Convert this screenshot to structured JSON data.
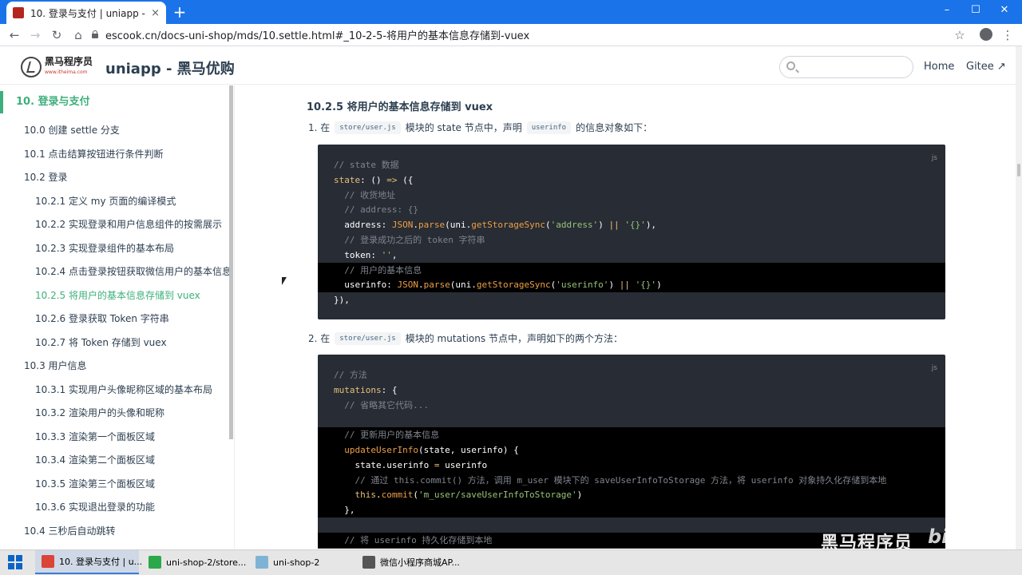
{
  "browser": {
    "tab_title": "10. 登录与支付 | uniapp - 黑马优...",
    "tab_close": "×",
    "new_tab": "+",
    "url": "escook.cn/docs-uni-shop/mds/10.settle.html#_10-2-5-将用户的基本信息存储到-vuex",
    "back": "←",
    "forward": "→",
    "reload": "↻",
    "home": "⌂",
    "bookmark": "☆",
    "menu": "⋮",
    "min": "–",
    "max": "☐",
    "close": "✕"
  },
  "site": {
    "logo_text": "黑马程序员",
    "logo_sub": "www.itheima.com",
    "title": "uniapp - 黑马优购",
    "search_placeholder": "",
    "nav": [
      "Home",
      "Gitee ↗"
    ]
  },
  "sidebar": {
    "top": "10. 登录与支付",
    "items": [
      {
        "label": "10.0 创建 settle 分支",
        "level": 1
      },
      {
        "label": "10.1 点击结算按钮进行条件判断",
        "level": 1
      },
      {
        "label": "10.2 登录",
        "level": 1
      },
      {
        "label": "10.2.1 定义 my 页面的编译模式",
        "level": 2
      },
      {
        "label": "10.2.2 实现登录和用户信息组件的按需展示",
        "level": 2
      },
      {
        "label": "10.2.3 实现登录组件的基本布局",
        "level": 2
      },
      {
        "label": "10.2.4 点击登录按钮获取微信用户的基本信息",
        "level": 2
      },
      {
        "label": "10.2.5 将用户的基本信息存储到 vuex",
        "level": 2,
        "active": true
      },
      {
        "label": "10.2.6 登录获取 Token 字符串",
        "level": 2
      },
      {
        "label": "10.2.7 将 Token 存储到 vuex",
        "level": 2
      },
      {
        "label": "10.3 用户信息",
        "level": 1
      },
      {
        "label": "10.3.1 实现用户头像昵称区域的基本布局",
        "level": 2
      },
      {
        "label": "10.3.2 渲染用户的头像和昵称",
        "level": 2
      },
      {
        "label": "10.3.3 渲染第一个面板区域",
        "level": 2
      },
      {
        "label": "10.3.4 渲染第二个面板区域",
        "level": 2
      },
      {
        "label": "10.3.5 渲染第三个面板区域",
        "level": 2
      },
      {
        "label": "10.3.6 实现退出登录的功能",
        "level": 2
      },
      {
        "label": "10.4 三秒后自动跳转",
        "level": 1
      }
    ]
  },
  "content": {
    "heading": "10.2.5 将用户的基本信息存储到 vuex",
    "step1": {
      "num": "1. 在",
      "code": "store/user.js",
      "mid": "模块的 state 节点中，声明",
      "code2": "userinfo",
      "end": "的信息对象如下："
    },
    "step2": {
      "num": "2. 在",
      "code": "store/user.js",
      "mid": "模块的 mutations 节点中，声明如下的两个方法："
    },
    "lang": "js",
    "code1": [
      {
        "hl": false,
        "parts": [
          [
            "c",
            "// state 数据"
          ]
        ]
      },
      {
        "hl": false,
        "parts": [
          [
            "k",
            "state"
          ],
          [
            "w",
            ": () "
          ],
          [
            "k",
            "=>"
          ],
          [
            "w",
            " ({"
          ]
        ]
      },
      {
        "hl": false,
        "parts": [
          [
            "c",
            "  // 收货地址"
          ]
        ]
      },
      {
        "hl": false,
        "parts": [
          [
            "c",
            "  // address: {}"
          ]
        ]
      },
      {
        "hl": false,
        "parts": [
          [
            "w",
            "  address: "
          ],
          [
            "f",
            "JSON"
          ],
          [
            "w",
            "."
          ],
          [
            "f",
            "parse"
          ],
          [
            "w",
            "(uni."
          ],
          [
            "f",
            "getStorageSync"
          ],
          [
            "w",
            "("
          ],
          [
            "s",
            "'address'"
          ],
          [
            "w",
            ") "
          ],
          [
            "p",
            "||"
          ],
          [
            "w",
            " "
          ],
          [
            "s",
            "'{}'"
          ],
          [
            "w",
            "),"
          ]
        ]
      },
      {
        "hl": false,
        "parts": [
          [
            "c",
            "  // 登录成功之后的 token 字符串"
          ]
        ]
      },
      {
        "hl": false,
        "parts": [
          [
            "w",
            "  token: "
          ],
          [
            "s",
            "''"
          ],
          [
            "w",
            ","
          ]
        ]
      },
      {
        "hl": true,
        "parts": [
          [
            "c",
            "  // 用户的基本信息"
          ]
        ]
      },
      {
        "hl": true,
        "parts": [
          [
            "w",
            "  userinfo: "
          ],
          [
            "f",
            "JSON"
          ],
          [
            "w",
            "."
          ],
          [
            "f",
            "parse"
          ],
          [
            "w",
            "(uni."
          ],
          [
            "f",
            "getStorageSync"
          ],
          [
            "w",
            "("
          ],
          [
            "s",
            "'userinfo'"
          ],
          [
            "w",
            ") "
          ],
          [
            "p",
            "||"
          ],
          [
            "w",
            " "
          ],
          [
            "s",
            "'{}'"
          ],
          [
            "w",
            ")"
          ]
        ]
      },
      {
        "hl": false,
        "parts": [
          [
            "w",
            "}),"
          ]
        ]
      }
    ],
    "code2": [
      {
        "hl": false,
        "parts": [
          [
            "c",
            "// 方法"
          ]
        ]
      },
      {
        "hl": false,
        "parts": [
          [
            "k",
            "mutations"
          ],
          [
            "w",
            ": {"
          ]
        ]
      },
      {
        "hl": false,
        "parts": [
          [
            "c",
            "  // 省略其它代码..."
          ]
        ]
      },
      {
        "hl": false,
        "parts": [
          [
            "w",
            ""
          ]
        ]
      },
      {
        "hl": true,
        "parts": [
          [
            "c",
            "  // 更新用户的基本信息"
          ]
        ]
      },
      {
        "hl": true,
        "parts": [
          [
            "f",
            "  updateUserInfo"
          ],
          [
            "w",
            "(state, userinfo) {"
          ]
        ]
      },
      {
        "hl": true,
        "parts": [
          [
            "w",
            "    state.userinfo "
          ],
          [
            "p",
            "="
          ],
          [
            "w",
            " userinfo"
          ]
        ]
      },
      {
        "hl": true,
        "parts": [
          [
            "c",
            "    // 通过 this.commit() 方法，调用 m_user 模块下的 saveUserInfoToStorage 方法，将 userinfo 对象持久化存储到本地"
          ]
        ]
      },
      {
        "hl": true,
        "parts": [
          [
            "k",
            "    this"
          ],
          [
            "w",
            "."
          ],
          [
            "f",
            "commit"
          ],
          [
            "w",
            "("
          ],
          [
            "s",
            "'m_user/saveUserInfoToStorage'"
          ],
          [
            "w",
            ")"
          ]
        ]
      },
      {
        "hl": true,
        "parts": [
          [
            "w",
            "  },"
          ]
        ]
      },
      {
        "hl": false,
        "parts": [
          [
            "w",
            ""
          ]
        ]
      },
      {
        "hl": true,
        "parts": [
          [
            "c",
            "  // 将 userinfo 持久化存储到本地"
          ]
        ]
      }
    ]
  },
  "watermark": {
    "text": "黑马程序员",
    "bili": "bilibili"
  },
  "taskbar": {
    "items": [
      {
        "label": "10. 登录与支付 | u...",
        "icon": "chrome-icon",
        "color": "#db4437",
        "active": true
      },
      {
        "label": "uni-shop-2/store...",
        "icon": "hbuilder-icon",
        "color": "#2aa84a",
        "active": false
      },
      {
        "label": "uni-shop-2",
        "icon": "wechat-devtools-icon",
        "color": "#7fb3d5",
        "active": false
      },
      {
        "label": "微信小程序商城AP...",
        "icon": "typora-icon",
        "color": "#555555",
        "active": false
      }
    ]
  },
  "colors": {
    "accent": "#3eaf7c",
    "chrome": "#1a73e8",
    "code_bg": "#282c34"
  }
}
